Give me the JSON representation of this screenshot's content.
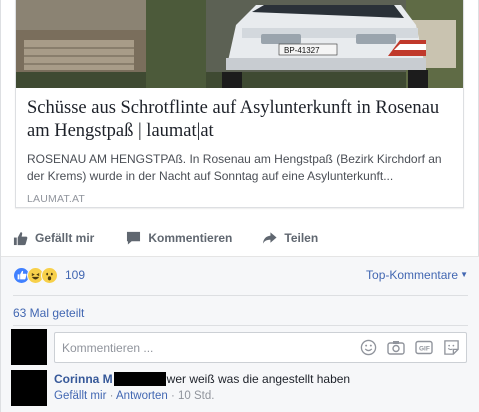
{
  "preview": {
    "title": "Schüsse aus Schrotflinte auf Asylunterkunft in Rosenau am Hengstpaß | laumat|at",
    "description": "ROSENAU AM HENGSTPAß. In Rosenau am Hengstpaß (Bezirk Kirchdorf an der Krems) wurde in der Nacht auf Sonntag auf eine Asylunterkunft...",
    "domain": "LAUMAT.AT",
    "plate": "BP-41327"
  },
  "actions": {
    "like": "Gefällt mir",
    "comment": "Kommentieren",
    "share": "Teilen"
  },
  "reactions": {
    "count": "109",
    "icons": [
      "like-icon",
      "haha-icon",
      "wow-icon"
    ],
    "top_comments": "Top-Kommentare"
  },
  "shares": "63 Mal geteilt",
  "comment_input": {
    "placeholder": "Kommentieren ...",
    "icons": [
      "emoji-icon",
      "camera-icon",
      "gif-icon",
      "sticker-icon"
    ]
  },
  "comment": {
    "author": "Corinna M",
    "text": "wer weiß was die angestellt haben",
    "like": "Gefällt mir",
    "reply": "Antworten",
    "time": "10 Std."
  },
  "colors": {
    "link": "#4267b2",
    "name": "#365899",
    "muted": "#90949c",
    "action": "#606770"
  }
}
